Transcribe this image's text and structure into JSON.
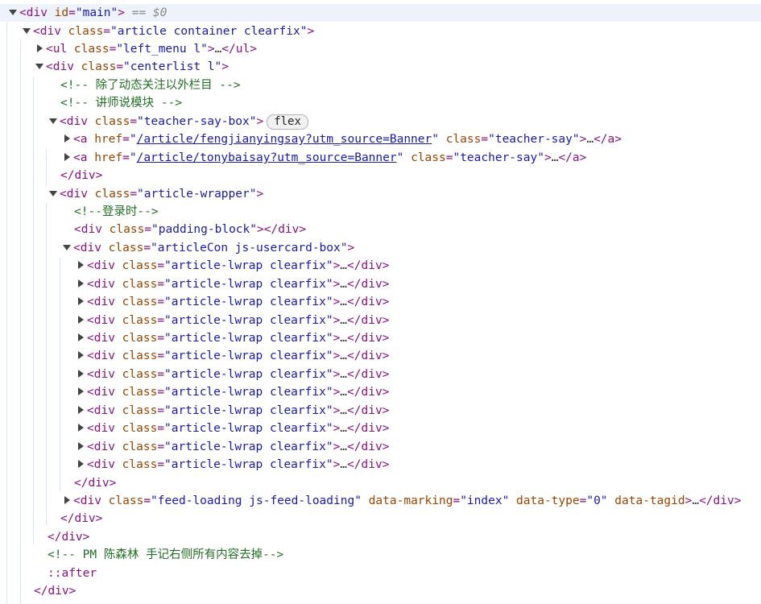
{
  "lines": [
    {
      "pre": "<div ",
      "a1": "id",
      "v1": "\"main\"",
      "post": ">",
      "extra": " == $0"
    },
    {
      "pre": "<div ",
      "a1": "class",
      "v1": "\"article container clearfix\"",
      "post": ">"
    },
    {
      "pre": "<ul ",
      "a1": "class",
      "v1": "\"left_menu l\"",
      "post": ">",
      "dots": "…",
      "close": "</ul>"
    },
    {
      "pre": "<div ",
      "a1": "class",
      "v1": "\"centerlist l\"",
      "post": ">"
    },
    {
      "comment": "<!-- 除了动态关注以外栏目 -->"
    },
    {
      "comment": "<!-- 讲师说模块 -->"
    },
    {
      "pre": "<div ",
      "a1": "class",
      "v1": "\"teacher-say-box\"",
      "post": ">",
      "badge": "flex"
    },
    {
      "pre": "<a ",
      "a1": "href",
      "v1q": "\"",
      "v1link": "/article/fengjianyingsay?utm_source=Banner",
      "v1q2": "\"",
      "sp": " ",
      "a2": "class",
      "v2": "\"teacher-say\"",
      "post": ">",
      "dots": "…",
      "close": "</a>"
    },
    {
      "pre": "<a ",
      "a1": "href",
      "v1q": "\"",
      "v1link": "/article/tonybaisay?utm_source=Banner",
      "v1q2": "\"",
      "sp": " ",
      "a2": "class",
      "v2": "\"teacher-say\"",
      "post": ">",
      "dots": "…",
      "close": "</a>"
    },
    {
      "closing": "</div>"
    },
    {
      "pre": "<div ",
      "a1": "class",
      "v1": "\"article-wrapper\"",
      "post": ">"
    },
    {
      "comment": "<!--登录时-->"
    },
    {
      "pre": "<div ",
      "a1": "class",
      "v1": "\"padding-block\"",
      "post": ">",
      "close": "</div>"
    },
    {
      "pre": "<div ",
      "a1": "class",
      "v1": "\"articleCon js-usercard-box\"",
      "post": ">"
    },
    {
      "pre": "<div ",
      "a1": "class",
      "v1": "\"article-lwrap clearfix\"",
      "post": ">",
      "dots": "…",
      "close": "</div>"
    },
    {
      "pre": "<div ",
      "a1": "class",
      "v1": "\"article-lwrap clearfix\"",
      "post": ">",
      "dots": "…",
      "close": "</div>"
    },
    {
      "pre": "<div ",
      "a1": "class",
      "v1": "\"article-lwrap clearfix\"",
      "post": ">",
      "dots": "…",
      "close": "</div>"
    },
    {
      "pre": "<div ",
      "a1": "class",
      "v1": "\"article-lwrap clearfix\"",
      "post": ">",
      "dots": "…",
      "close": "</div>"
    },
    {
      "pre": "<div ",
      "a1": "class",
      "v1": "\"article-lwrap clearfix\"",
      "post": ">",
      "dots": "…",
      "close": "</div>"
    },
    {
      "pre": "<div ",
      "a1": "class",
      "v1": "\"article-lwrap clearfix\"",
      "post": ">",
      "dots": "…",
      "close": "</div>"
    },
    {
      "pre": "<div ",
      "a1": "class",
      "v1": "\"article-lwrap clearfix\"",
      "post": ">",
      "dots": "…",
      "close": "</div>"
    },
    {
      "pre": "<div ",
      "a1": "class",
      "v1": "\"article-lwrap clearfix\"",
      "post": ">",
      "dots": "…",
      "close": "</div>"
    },
    {
      "pre": "<div ",
      "a1": "class",
      "v1": "\"article-lwrap clearfix\"",
      "post": ">",
      "dots": "…",
      "close": "</div>"
    },
    {
      "pre": "<div ",
      "a1": "class",
      "v1": "\"article-lwrap clearfix\"",
      "post": ">",
      "dots": "…",
      "close": "</div>"
    },
    {
      "pre": "<div ",
      "a1": "class",
      "v1": "\"article-lwrap clearfix\"",
      "post": ">",
      "dots": "…",
      "close": "</div>"
    },
    {
      "pre": "<div ",
      "a1": "class",
      "v1": "\"article-lwrap clearfix\"",
      "post": ">",
      "dots": "…",
      "close": "</div>"
    },
    {
      "closing": "</div>"
    },
    {
      "pre": "<div ",
      "a1": "class",
      "v1": "\"feed-loading js-feed-loading\"",
      "sp": " ",
      "a2": "data-marking",
      "v2": "\"index\"",
      "sp2": " ",
      "a3": "data-type",
      "v3": "\"0\"",
      "sp3": " ",
      "a4": "data-tagid",
      "post": ">",
      "dots": "…",
      "close": "</div>"
    },
    {
      "closing": "</div>"
    },
    {
      "closing": "</div>"
    },
    {
      "comment": "<!-- PM 陈森林 手记右侧所有内容去掉-->"
    },
    {
      "pseudo": "::after"
    },
    {
      "closing": "</div>"
    }
  ]
}
